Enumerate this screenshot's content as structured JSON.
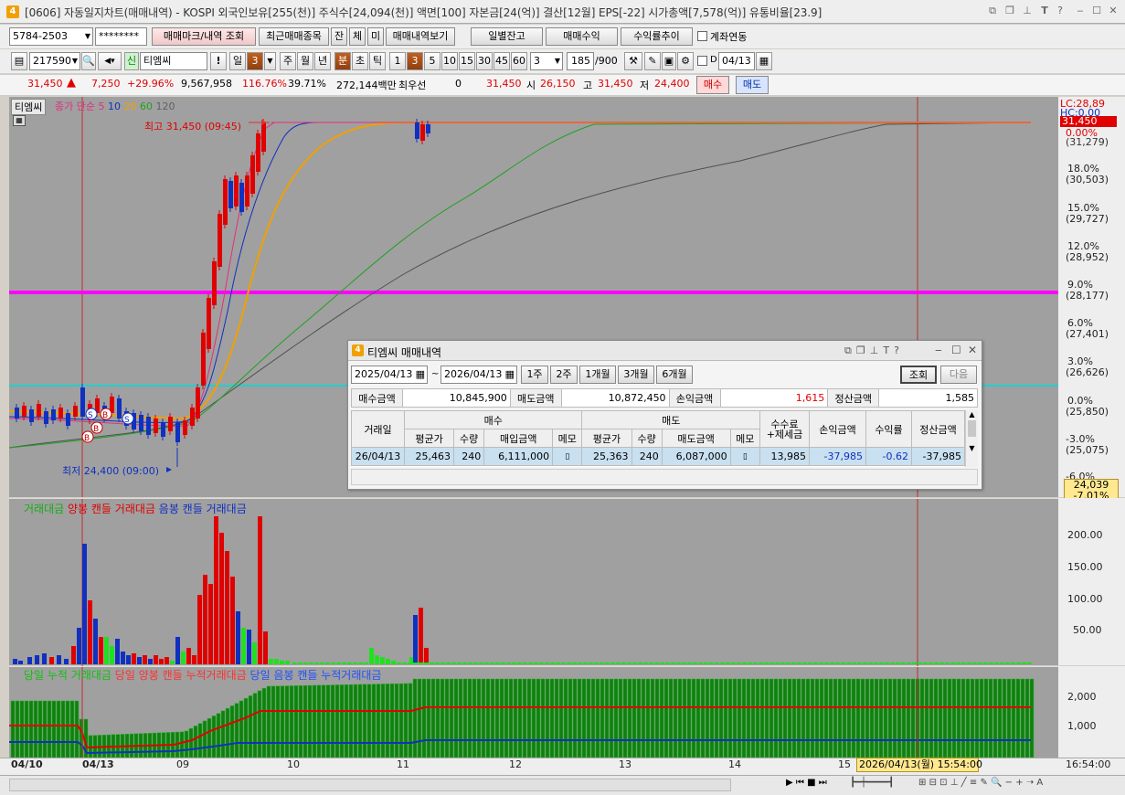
{
  "window": {
    "screen_no": "[0606]",
    "title": "자동일지차트(매매내역) - KOSPI 외국인보유[255(천)] 주식수[24,094(천)] 액면[100] 자본금[24(억)] 결산[12월] EPS[-22] 시가총액[7,578(억)] 유통비율[23.9]"
  },
  "toolbar1": {
    "account": "5784-2503",
    "password": "********",
    "btn_mark": "매매마크/내역 조회",
    "btn_recent": "최근매매종목",
    "btn_jan": "잔",
    "btn_che": "체",
    "btn_mi": "미",
    "btn_view": "매매내역보기",
    "btn_daily": "일별잔고",
    "btn_profit": "매매수익",
    "btn_trend": "수익률추이",
    "chk_link": "계좌연동"
  },
  "toolbar2": {
    "code": "217590",
    "shin": "신",
    "name": "티엠씨",
    "excl": "!",
    "il": "일",
    "il_num": "3",
    "periods": [
      "주",
      "월",
      "년",
      "분",
      "초",
      "틱"
    ],
    "minutes": [
      "1",
      "3",
      "5",
      "10",
      "15",
      "30",
      "45",
      "60"
    ],
    "interval": "3",
    "count": "185",
    "count_max": "/900",
    "date_chk": "D",
    "date": "04/13"
  },
  "infobar": {
    "price": "31,450",
    "up": "▲",
    "change": "7,250",
    "change_pct": "+29.96%",
    "volume": "9,567,958",
    "vol_ratio": "116.76%",
    "turnover": "39.71%",
    "amount": "272,144백만",
    "pref_label": "최우선",
    "pref_val": "0",
    "ask": "31,450",
    "open_label": "시",
    "open": "26,150",
    "high_label": "고",
    "high": "31,450",
    "low_label": "저",
    "low": "24,400",
    "buy": "매수",
    "sell": "매도"
  },
  "price_panel": {
    "name": "티엠씨",
    "legend_label": "종가 단순",
    "ma": [
      "5",
      "10",
      "20",
      "60",
      "120"
    ],
    "ma_colors": [
      "#e03080",
      "#1030c0",
      "#f0a000",
      "#20a020",
      "#606060"
    ],
    "high_note": "최고 31,450 (09:45)",
    "low_note": "최저 24,400 (09:00)",
    "lc": "LC:28,89",
    "hc": "HC:0.00",
    "cur": "31,450",
    "cur_pct": "0.00%",
    "cursor_price": "24,039",
    "cursor_pct": "-7.01%",
    "axis": [
      {
        "pct": "(31,279)"
      },
      {
        "pct": "18.0%",
        "price": "(30,503)"
      },
      {
        "pct": "15.0%",
        "price": "(29,727)"
      },
      {
        "pct": "12.0%",
        "price": "(28,952)"
      },
      {
        "pct": "9.0%",
        "price": "(28,177)"
      },
      {
        "pct": "6.0%",
        "price": "(27,401)"
      },
      {
        "pct": "3.0%",
        "price": "(26,626)"
      },
      {
        "pct": "0.0%",
        "price": "(25,850)"
      },
      {
        "pct": "-3.0%",
        "price": "(25,075)"
      },
      {
        "pct": "-6.0%"
      }
    ]
  },
  "amount_panel": {
    "l1": "거래대금",
    "l2": "양봉 캔들 거래대금",
    "l3": "음봉 캔들 거래대금",
    "axis": [
      "200.00",
      "150.00",
      "100.00",
      "50.00"
    ]
  },
  "cum_panel": {
    "l1": "당일 누적 거래대금",
    "l2": "당일 양봉 캔들 누적거래대금",
    "l3": "당일 음봉 캔들 누적거래대금",
    "axis": [
      "2,000",
      "1,000"
    ]
  },
  "xaxis": {
    "labels": [
      "04/10",
      "04/13",
      "09",
      "10",
      "11",
      "12",
      "13",
      "14",
      "15"
    ],
    "cursor": "2026/04/13(월) 15:54:00",
    "time": "16:54:00"
  },
  "popup": {
    "title": "티엠씨 매매내역",
    "from": "2025/04/13",
    "tilde": "~",
    "to": "2026/04/13",
    "ranges": [
      "1주",
      "2주",
      "1개월",
      "3개월",
      "6개월"
    ],
    "query": "조회",
    "next": "다음",
    "summary": {
      "buy_label": "매수금액",
      "buy": "10,845,900",
      "sell_label": "매도금액",
      "sell": "10,872,450",
      "pl_label": "손익금액",
      "pl": "1,615",
      "settle_label": "정산금액",
      "settle": "1,585"
    },
    "headers": {
      "date": "거래일",
      "buy": "매수",
      "sell": "매도",
      "fee": "수수료 +제세금",
      "pl": "손익금액",
      "ret": "수익률",
      "settle": "정산금액",
      "avg": "평균가",
      "qty": "수량",
      "buy_amt": "매입금액",
      "memo": "메모",
      "sell_amt": "매도금액"
    },
    "rows": [
      {
        "date": "26/04/13",
        "bavg": "25,463",
        "bqty": "240",
        "bamt": "6,111,000",
        "savg": "25,363",
        "sqty": "240",
        "samt": "6,087,000",
        "fee": "13,985",
        "pl": "-37,985",
        "ret": "-0.62",
        "settle": "-37,985"
      }
    ]
  }
}
